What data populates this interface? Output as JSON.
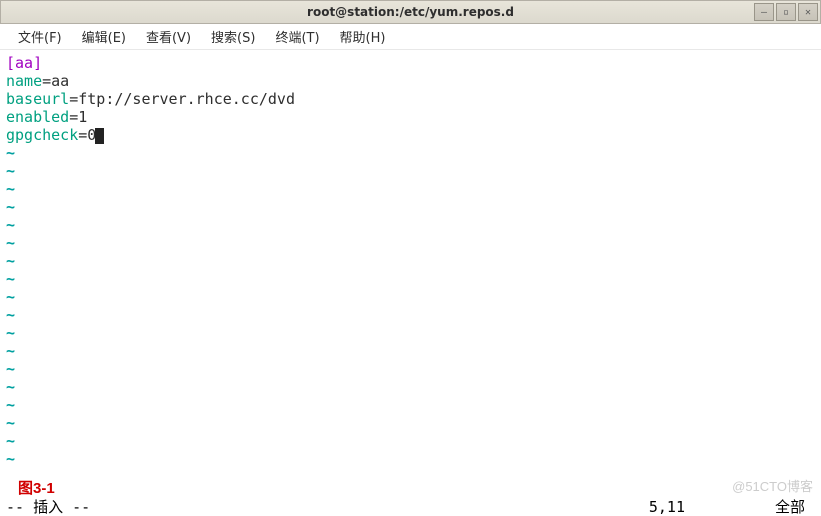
{
  "titlebar": {
    "title": "root@station:/etc/yum.repos.d"
  },
  "window_controls": {
    "minimize": "–",
    "maximize": "▫",
    "close": "✕"
  },
  "menubar": {
    "items": [
      {
        "label": "文件(F)"
      },
      {
        "label": "编辑(E)"
      },
      {
        "label": "查看(V)"
      },
      {
        "label": "搜索(S)"
      },
      {
        "label": "终端(T)"
      },
      {
        "label": "帮助(H)"
      }
    ]
  },
  "editor": {
    "lines": [
      {
        "type": "section",
        "text": "[aa]"
      },
      {
        "type": "kv",
        "key": "name",
        "eq": "=",
        "val": "aa"
      },
      {
        "type": "kv",
        "key": "baseurl",
        "eq": "=",
        "val": "ftp://server.rhce.cc/dvd"
      },
      {
        "type": "kv",
        "key": "enabled",
        "eq": "=",
        "val": "1"
      },
      {
        "type": "kv_cursor",
        "key": "gpgcheck",
        "eq": "=",
        "val": "0"
      }
    ],
    "empty_marker": "~",
    "empty_count": 18
  },
  "annotation": "图3-1",
  "statusbar": {
    "mode": "-- 插入 --",
    "position": "5,11",
    "scroll": "全部"
  },
  "watermark": "@51CTO博客"
}
